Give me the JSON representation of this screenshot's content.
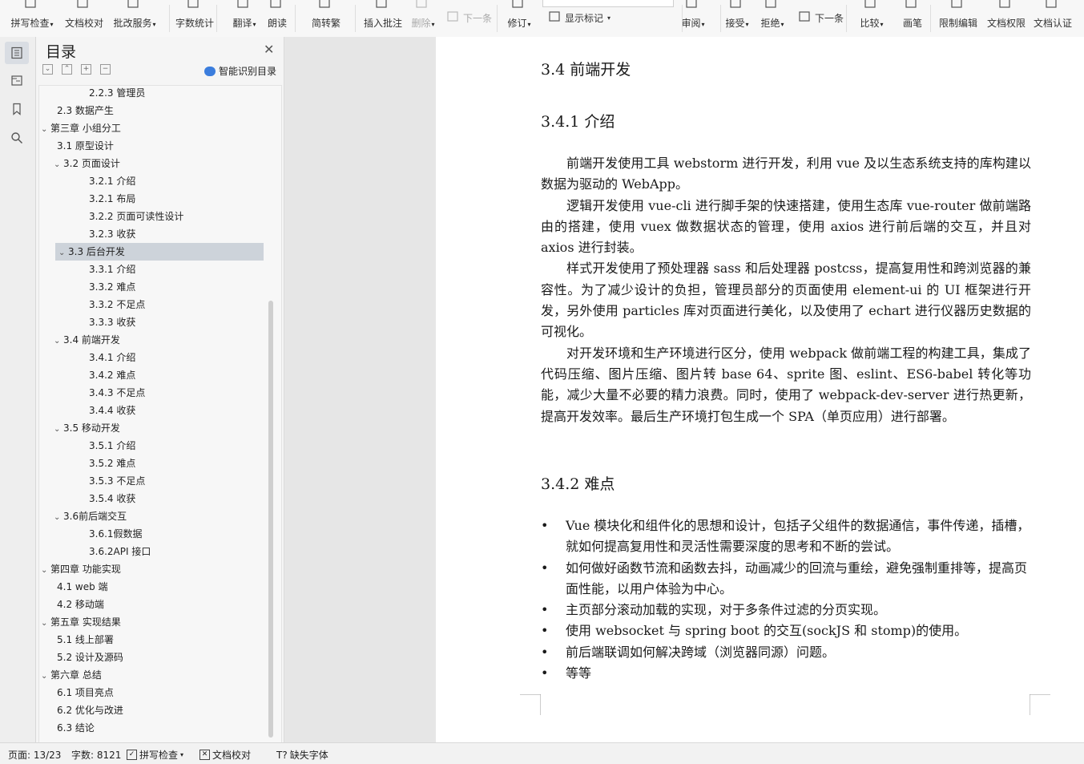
{
  "toolbar": {
    "buttons": [
      {
        "label": "拼写检查",
        "dropdown": true,
        "icon": "spellcheck-icon"
      },
      {
        "label": "文档校对",
        "icon": "proofread-icon"
      },
      {
        "label": "批改服务",
        "dropdown": true,
        "icon": "correction-service-icon"
      },
      {
        "label": "字数统计",
        "icon": "word-count-icon"
      },
      {
        "label": "翻译",
        "dropdown": true,
        "icon": "translate-icon"
      },
      {
        "label": "朗读",
        "icon": "read-aloud-icon"
      },
      {
        "label": "简转繁",
        "icon": "simplified-to-traditional-icon"
      },
      {
        "label": "插入批注",
        "icon": "insert-comment-icon"
      },
      {
        "label": "删除",
        "dropdown": true,
        "disabled": true,
        "icon": "delete-comment-icon"
      },
      {
        "label": "下一条",
        "disabled": true,
        "icon": "next-comment-icon"
      },
      {
        "label": "修订",
        "dropdown": true,
        "icon": "track-changes-icon"
      },
      {
        "label": "显示标记",
        "dropdown": true,
        "icon": "show-markup-icon"
      },
      {
        "label": "审阅",
        "dropdown": true,
        "icon": "review-pane-icon"
      },
      {
        "label": "接受",
        "dropdown": true,
        "icon": "accept-icon"
      },
      {
        "label": "拒绝",
        "dropdown": true,
        "icon": "reject-icon"
      },
      {
        "label": "下一条",
        "icon": "next-change-icon"
      },
      {
        "label": "比较",
        "dropdown": true,
        "icon": "compare-icon"
      },
      {
        "label": "画笔",
        "icon": "pen-icon"
      },
      {
        "label": "限制编辑",
        "icon": "restrict-edit-icon"
      },
      {
        "label": "文档权限",
        "icon": "doc-permission-icon"
      },
      {
        "label": "文档认证",
        "icon": "doc-certify-icon"
      }
    ]
  },
  "nav": {
    "title": "目录",
    "smart_label": "智能识别目录",
    "items": [
      {
        "label": "2.2.3  管理员",
        "level": 3,
        "caret": false,
        "selected": false
      },
      {
        "label": "2.3  数据产生",
        "level": 2,
        "caret": false,
        "selected": false
      },
      {
        "label": "第三章  小组分工",
        "level": 1,
        "caret": true,
        "selected": false
      },
      {
        "label": "3.1  原型设计",
        "level": 2,
        "caret": false,
        "selected": false
      },
      {
        "label": "3.2  页面设计",
        "level": 2,
        "caret": true,
        "selected": false
      },
      {
        "label": "3.2.1  介绍",
        "level": 3,
        "caret": false,
        "selected": false
      },
      {
        "label": "3.2.1  布局",
        "level": 3,
        "caret": false,
        "selected": false
      },
      {
        "label": "3.2.2  页面可读性设计",
        "level": 3,
        "caret": false,
        "selected": false
      },
      {
        "label": "3.2.3  收获",
        "level": 3,
        "caret": false,
        "selected": false
      },
      {
        "label": "3.3  后台开发",
        "level": 2,
        "caret": true,
        "selected": true
      },
      {
        "label": "3.3.1  介绍",
        "level": 3,
        "caret": false,
        "selected": false
      },
      {
        "label": "3.3.2  难点",
        "level": 3,
        "caret": false,
        "selected": false
      },
      {
        "label": "3.3.2  不足点",
        "level": 3,
        "caret": false,
        "selected": false
      },
      {
        "label": "3.3.3  收获",
        "level": 3,
        "caret": false,
        "selected": false
      },
      {
        "label": "3.4  前端开发",
        "level": 2,
        "caret": true,
        "selected": false
      },
      {
        "label": "3.4.1  介绍",
        "level": 3,
        "caret": false,
        "selected": false
      },
      {
        "label": "3.4.2  难点",
        "level": 3,
        "caret": false,
        "selected": false
      },
      {
        "label": "3.4.3  不足点",
        "level": 3,
        "caret": false,
        "selected": false
      },
      {
        "label": "3.4.4  收获",
        "level": 3,
        "caret": false,
        "selected": false
      },
      {
        "label": "3.5  移动开发",
        "level": 2,
        "caret": true,
        "selected": false
      },
      {
        "label": "3.5.1  介绍",
        "level": 3,
        "caret": false,
        "selected": false
      },
      {
        "label": "3.5.2  难点",
        "level": 3,
        "caret": false,
        "selected": false
      },
      {
        "label": "3.5.3  不足点",
        "level": 3,
        "caret": false,
        "selected": false
      },
      {
        "label": "3.5.4  收获",
        "level": 3,
        "caret": false,
        "selected": false
      },
      {
        "label": "3.6前后端交互",
        "level": 2,
        "caret": true,
        "selected": false
      },
      {
        "label": "3.6.1假数据",
        "level": 3,
        "caret": false,
        "selected": false
      },
      {
        "label": "3.6.2API 接口",
        "level": 3,
        "caret": false,
        "selected": false
      },
      {
        "label": "第四章  功能实现",
        "level": 1,
        "caret": true,
        "selected": false
      },
      {
        "label": "4.1 web 端",
        "level": 2,
        "caret": false,
        "selected": false
      },
      {
        "label": "4.2  移动端",
        "level": 2,
        "caret": false,
        "selected": false
      },
      {
        "label": "第五章  实现结果",
        "level": 1,
        "caret": true,
        "selected": false
      },
      {
        "label": "5.1  线上部署",
        "level": 2,
        "caret": false,
        "selected": false
      },
      {
        "label": "5.2  设计及源码",
        "level": 2,
        "caret": false,
        "selected": false
      },
      {
        "label": "第六章  总结",
        "level": 1,
        "caret": true,
        "selected": false
      },
      {
        "label": "6.1  项目亮点",
        "level": 2,
        "caret": false,
        "selected": false
      },
      {
        "label": "6.2  优化与改进",
        "level": 2,
        "caret": false,
        "selected": false
      },
      {
        "label": "6.3  结论",
        "level": 2,
        "caret": false,
        "selected": false
      }
    ]
  },
  "doc": {
    "h_section": "3.4  前端开发",
    "h_intro": "3.4.1  介绍",
    "paragraphs": [
      "前端开发使用工具 webstorm 进行开发，利用 vue 及以生态系统支持的库构建以数据为驱动的 WebApp。",
      "逻辑开发使用 vue-cli 进行脚手架的快速搭建，使用生态库 vue-router 做前端路由的搭建，使用 vuex 做数据状态的管理，使用 axios 进行前后端的交互，并且对 axios 进行封装。",
      "样式开发使用了预处理器 sass 和后处理器 postcss，提高复用性和跨浏览器的兼容性。为了减少设计的负担，管理员部分的页面使用 element-ui 的 UI 框架进行开发，另外使用 particles 库对页面进行美化，以及使用了 echart 进行仪器历史数据的可视化。",
      "对开发环境和生产环境进行区分，使用 webpack 做前端工程的构建工具，集成了代码压缩、图片压缩、图片转 base 64、sprite 图、eslint、ES6-babel 转化等功能，减少大量不必要的精力浪费。同时，使用了 webpack-dev-server 进行热更新，提高开发效率。最后生产环境打包生成一个 SPA（单页应用）进行部署。"
    ],
    "h_difficulty": "3.4.2  难点",
    "bullets": [
      "Vue 模块化和组件化的思想和设计，包括子父组件的数据通信，事件传递，插槽，就如何提高复用性和灵活性需要深度的思考和不断的尝试。",
      "如何做好函数节流和函数去抖，动画减少的回流与重绘，避免强制重排等，提高页面性能，以用户体验为中心。",
      "主页部分滚动加载的实现，对于多条件过滤的分页实现。",
      "使用 websocket 与 spring boot 的交互(sockJS 和 stomp)的使用。",
      "前后端联调如何解决跨域（浏览器同源）问题。",
      "等等"
    ]
  },
  "status": {
    "page": "页面: 13/23",
    "words": "字数: 8121",
    "spell": "拼写检查",
    "proof": "文档校对",
    "font": "缺失字体"
  },
  "colors": {
    "accent": "#3b7ddd",
    "selected_row": "#cdd3da"
  }
}
